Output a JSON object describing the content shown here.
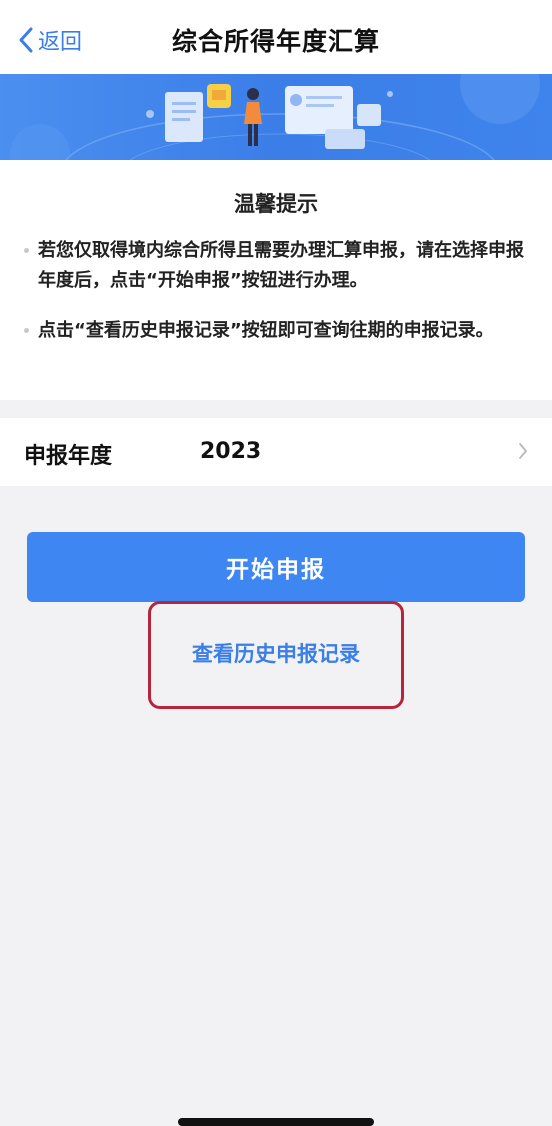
{
  "nav": {
    "back_label": "返回",
    "title": "综合所得年度汇算"
  },
  "tips": {
    "title": "温馨提示",
    "items": [
      "若您仅取得境内综合所得且需要办理汇算申报，请在选择申报年度后，点击“开始申报”按钮进行办理。",
      "点击“查看历史申报记录”按钮即可查询往期的申报记录。"
    ]
  },
  "year_row": {
    "label": "申报年度",
    "value": "2023"
  },
  "actions": {
    "start_label": "开始申报",
    "history_label": "查看历史申报记录"
  },
  "colors": {
    "accent": "#3e86f1",
    "link": "#3a7ee6",
    "highlight": "#b5253b"
  }
}
